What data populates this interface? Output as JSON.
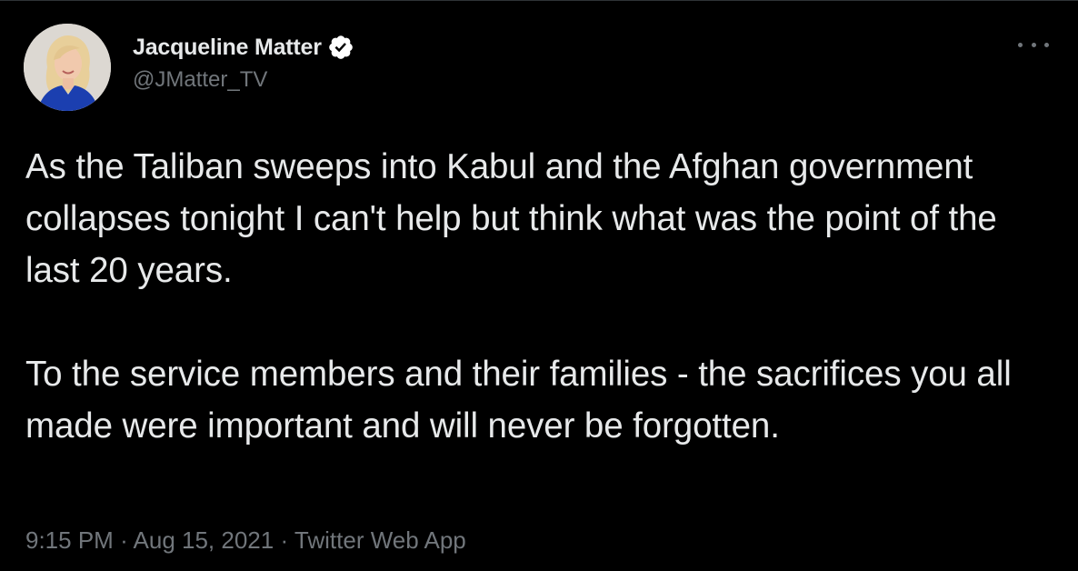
{
  "author": {
    "display_name": "Jacqueline Matter",
    "handle": "@JMatter_TV",
    "verified": true,
    "avatar_icon": "profile-photo"
  },
  "tweet": {
    "paragraphs": [
      "As the Taliban sweeps into Kabul and the Afghan government collapses tonight I can't help but think what was the point of the last 20 years.",
      "To the service members and their families - the sacrifices you all made were important and will never be forgotten."
    ]
  },
  "meta": {
    "time": "9:15 PM",
    "date": "Aug 15, 2021",
    "source": "Twitter Web App",
    "separator": "·"
  },
  "colors": {
    "background": "#000000",
    "text": "#e7e9ea",
    "secondary": "#71767b",
    "verified": "#ffffff"
  }
}
